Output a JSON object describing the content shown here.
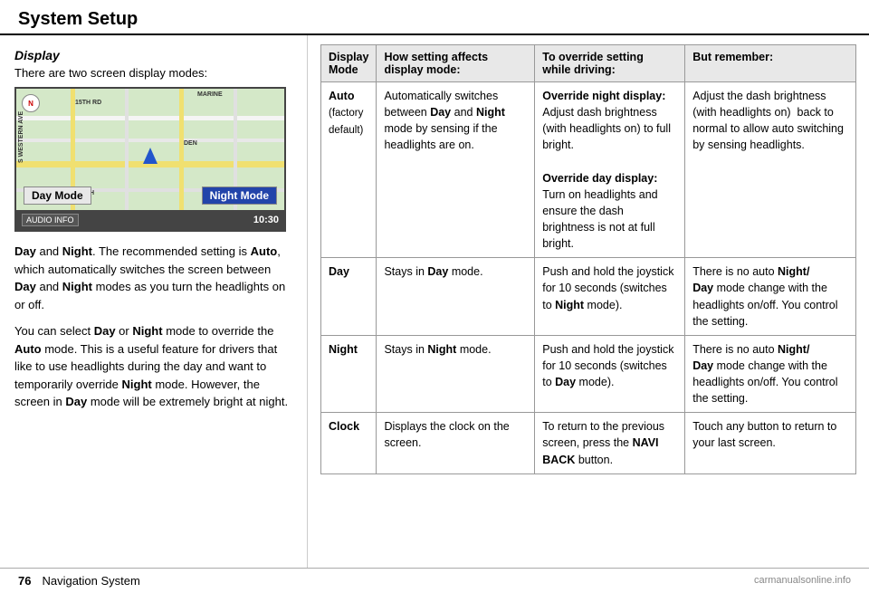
{
  "header": {
    "title": "System Setup"
  },
  "left": {
    "section_title": "Display",
    "intro": "There are two screen display modes:",
    "map": {
      "day_label": "Day Mode",
      "night_label": "Night Mode",
      "time": "10:30",
      "audio_label": "AUDIO INFO",
      "compass": "N"
    },
    "body_p1_plain1": "Day",
    "body_p1_and": " and ",
    "body_p1_bold1": "Night",
    "body_p1_rest": ". The recommended setting is ",
    "body_p1_bold2": "Auto",
    "body_p1_rest2": ", which automatically switches the screen between ",
    "body_p1_bold3": "Day",
    "body_p1_rest3": " and ",
    "body_p1_bold4": "Night",
    "body_p1_rest4": " modes as you turn the headlights on or off.",
    "body_p2_start": "You can select ",
    "body_p2_bold1": "Day",
    "body_p2_mid1": " or ",
    "body_p2_bold2": "Night",
    "body_p2_mid2": " mode to override the ",
    "body_p2_bold3": "Auto",
    "body_p2_mid3": " mode. This is a useful feature for drivers that like to use headlights during the day and want to temporarily override ",
    "body_p2_bold4": "Night",
    "body_p2_mid4": " mode. However, the screen in ",
    "body_p2_bold5": "Day",
    "body_p2_end": " mode will be extremely bright at night."
  },
  "table": {
    "headers": [
      "Display Mode",
      "How setting affects display mode:",
      "To override setting while driving:",
      "But remember:"
    ],
    "rows": [
      {
        "mode": "Auto",
        "mode_note": "(factory default)",
        "how": "Automatically switches between Day and Night mode by sensing if the headlights are on.",
        "how_bolds": [
          "Day",
          "Night"
        ],
        "override": "Override night display: Adjust dash brightness (with headlights on) to full bright.\nOverride day display: Turn on headlights and ensure the dash brightness is not at full bright.",
        "override_bolds": [
          "Override night display:",
          "Override day display:"
        ],
        "remember": "Adjust the dash brightness (with headlights on)  back to normal to allow auto switching by sensing headlights."
      },
      {
        "mode": "Day",
        "mode_note": "",
        "how": "Stays in Day mode.",
        "how_bolds": [
          "Day"
        ],
        "override": "Push and hold the joystick for 10 seconds (switches to Night mode).",
        "override_bolds": [
          "Night"
        ],
        "remember": "There is no auto Night/ Day mode change with the headlights on/off. You control the setting.",
        "remember_bolds": [
          "Night/",
          "Day"
        ]
      },
      {
        "mode": "Night",
        "mode_note": "",
        "how": "Stays in Night mode.",
        "how_bolds": [
          "Night"
        ],
        "override": "Push and hold the joystick for 10 seconds (switches to Day mode).",
        "override_bolds": [
          "Day"
        ],
        "remember": "There is no auto Night/ Day mode change with the headlights on/off. You control the setting.",
        "remember_bolds": [
          "Night/",
          "Day"
        ]
      },
      {
        "mode": "Clock",
        "mode_note": "",
        "how": "Displays the clock on the screen.",
        "how_bolds": [],
        "override": "To return to the previous screen, press the NAVI BACK button.",
        "override_bolds": [
          "NAVI BACK"
        ],
        "remember": "Touch any button to return to your last screen.",
        "remember_bolds": []
      }
    ]
  },
  "footer": {
    "page_number": "76",
    "brand": "Navigation System",
    "watermark": "carmanualsonline.info"
  }
}
